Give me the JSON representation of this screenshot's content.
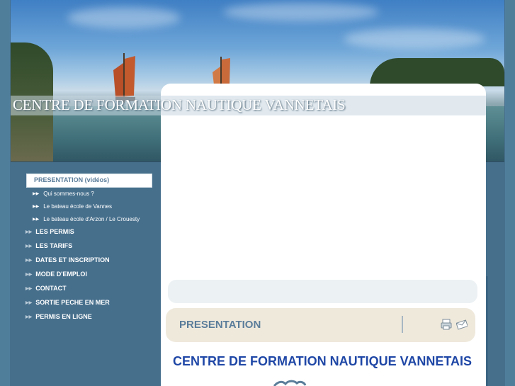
{
  "site": {
    "title": "CENTRE DE FORMATION NAUTIQUE VANNETAIS"
  },
  "nav": {
    "active": {
      "label": "PRESENTATION (vidéos)"
    },
    "sub_items": [
      {
        "label": "Qui sommes-nous ?"
      },
      {
        "label": "Le bateau école de Vannes"
      },
      {
        "label": "Le bateau école d'Arzon / Le Crouesty"
      }
    ],
    "items": [
      {
        "label": "LES PERMIS"
      },
      {
        "label": "LES TARIFS"
      },
      {
        "label": "DATES ET INSCRIPTION"
      },
      {
        "label": "MODE D'EMPLOI"
      },
      {
        "label": "CONTACT"
      },
      {
        "label": "SORTIE PECHE EN MER"
      },
      {
        "label": "PERMIS EN LIGNE"
      }
    ]
  },
  "section": {
    "title": "PRESENTATION",
    "tools": [
      {
        "icon": "print-icon"
      },
      {
        "icon": "email-icon"
      }
    ]
  },
  "main": {
    "heading": "CENTRE DE FORMATION NAUTIQUE VANNETAIS"
  },
  "colors": {
    "background": "#4f7e9b",
    "accent_blue": "#1f47a6",
    "nav_text": "#ffffff",
    "section_text": "#5b7d9a",
    "section_bg": "#efe9dc"
  }
}
